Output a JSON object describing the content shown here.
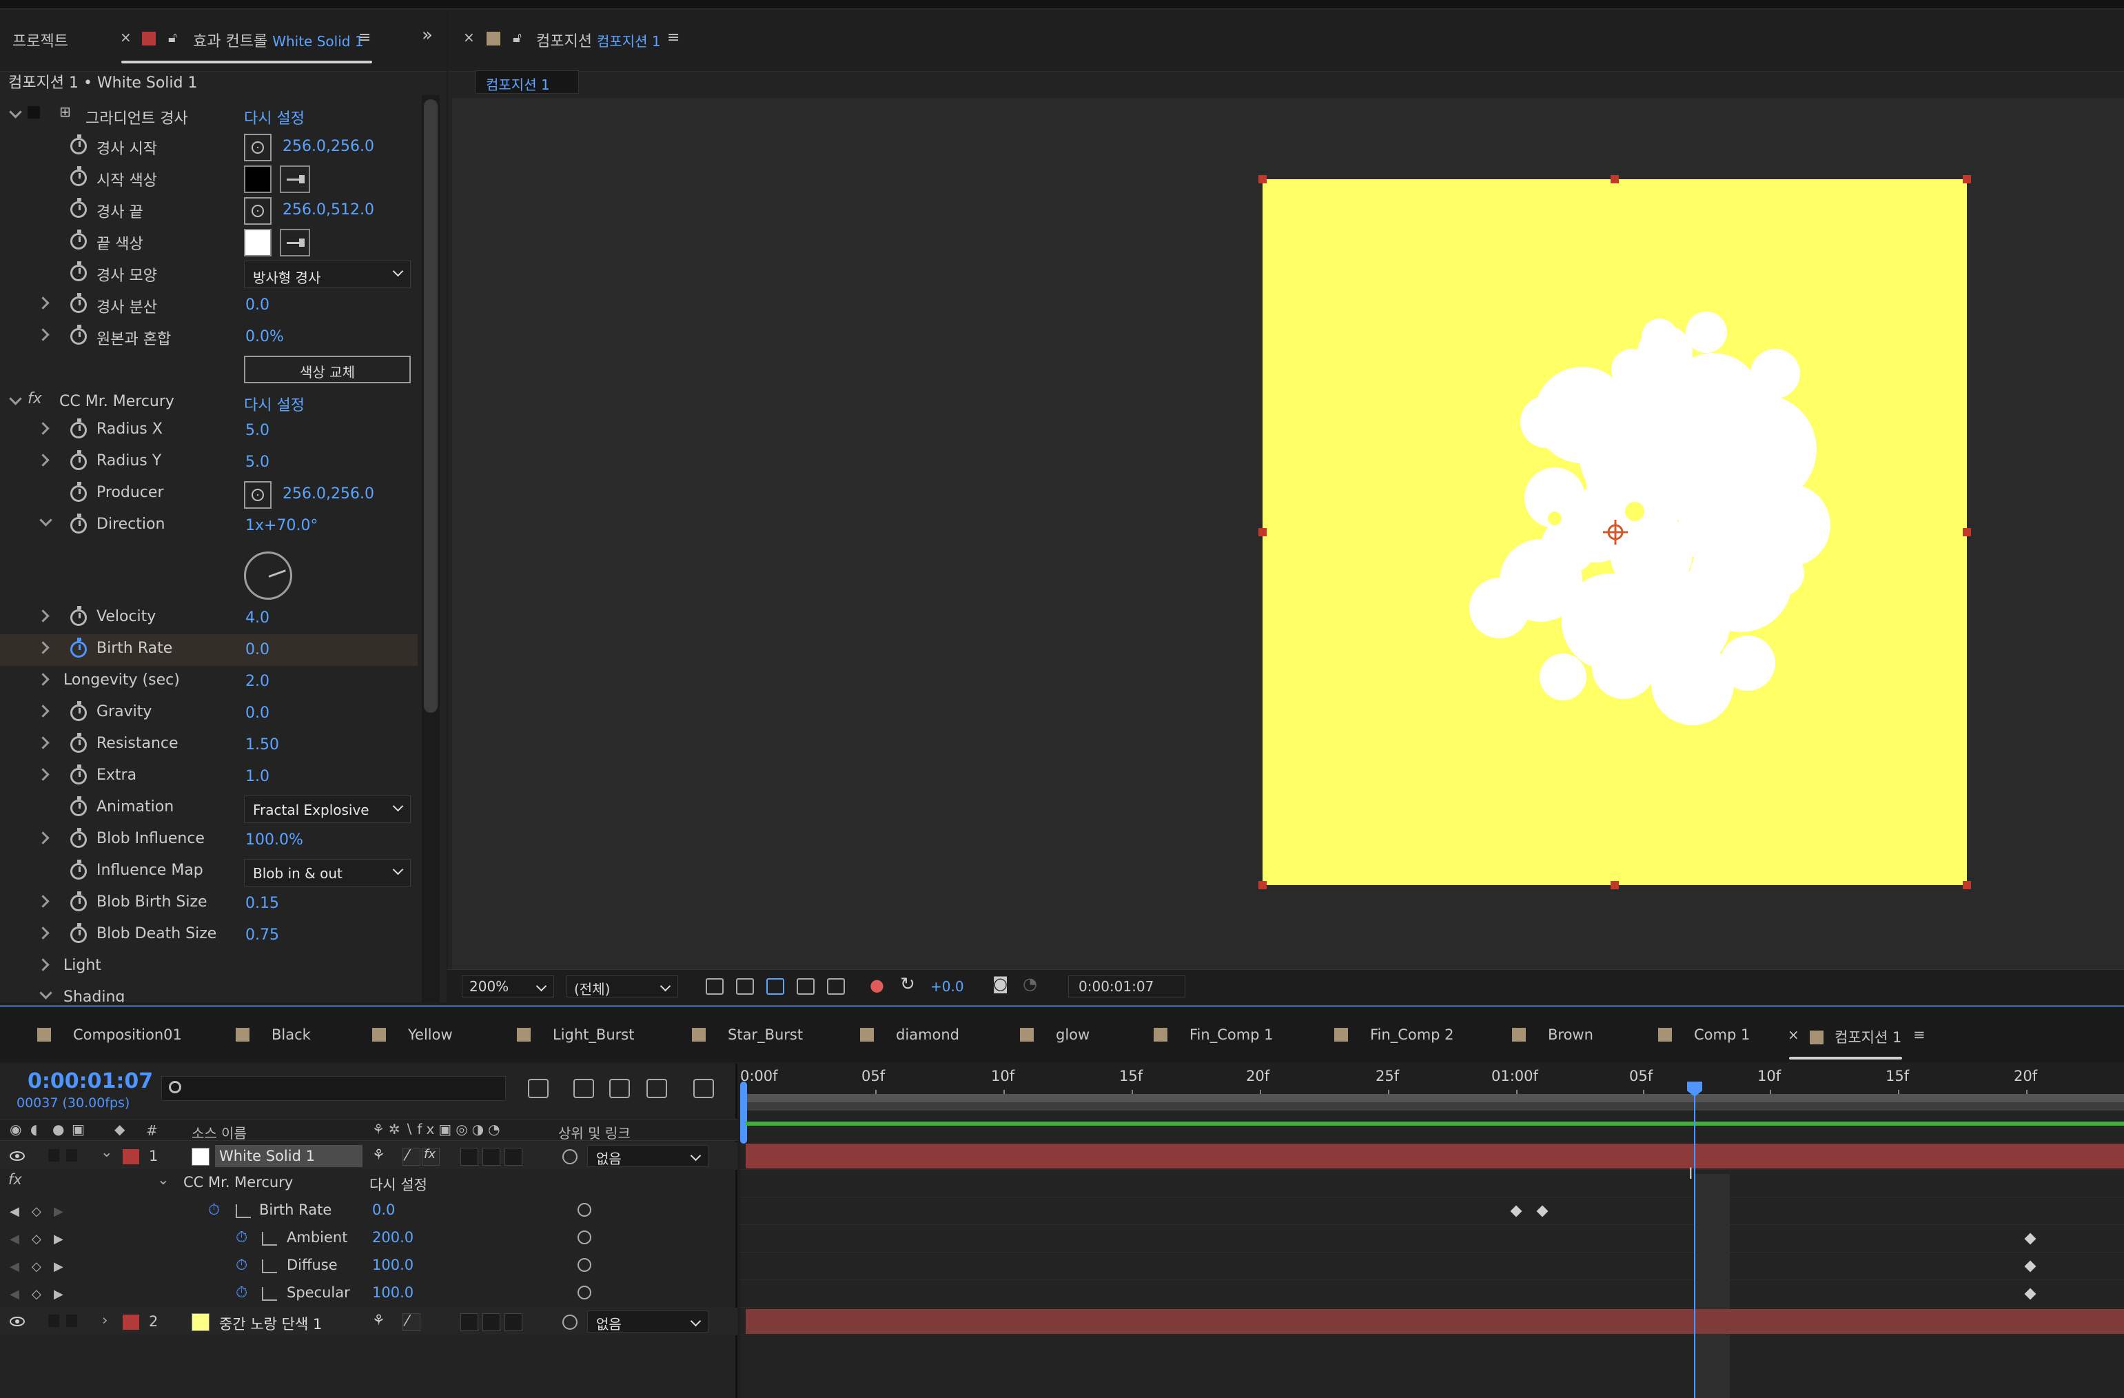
{
  "effects_panel": {
    "tabs": {
      "project": "프로젝트",
      "effect_controls_prefix": "효과 컨트롤",
      "effect_controls_target": "White Solid 1"
    },
    "subtitle": "컴포지션 1 • White Solid 1",
    "gradient": {
      "name": "그라디언트 경사",
      "reset": "다시 설정",
      "start_point": {
        "label": "경사 시작",
        "value": "256.0,256.0"
      },
      "start_color": {
        "label": "시작 색상",
        "color": "#000000"
      },
      "end_point": {
        "label": "경사 끝",
        "value": "256.0,512.0"
      },
      "end_color": {
        "label": "끝 색상",
        "color": "#ffffff"
      },
      "shape": {
        "label": "경사 모양",
        "value": "방사형 경사"
      },
      "scatter": {
        "label": "경사 분산",
        "value": "0.0"
      },
      "blend": {
        "label": "원본과 혼합",
        "value": "0.0%"
      },
      "swap_button": "색상 교체"
    },
    "mercury": {
      "name": "CC Mr. Mercury",
      "reset": "다시 설정",
      "radius_x": {
        "label": "Radius X",
        "value": "5.0"
      },
      "radius_y": {
        "label": "Radius Y",
        "value": "5.0"
      },
      "producer": {
        "label": "Producer",
        "value": "256.0,256.0"
      },
      "direction": {
        "label": "Direction",
        "value": "1x+70.0°"
      },
      "velocity": {
        "label": "Velocity",
        "value": "4.0"
      },
      "birth_rate": {
        "label": "Birth Rate",
        "value": "0.0"
      },
      "longevity": {
        "label": "Longevity (sec)",
        "value": "2.0"
      },
      "gravity": {
        "label": "Gravity",
        "value": "0.0"
      },
      "resistance": {
        "label": "Resistance",
        "value": "1.50"
      },
      "extra": {
        "label": "Extra",
        "value": "1.0"
      },
      "animation": {
        "label": "Animation",
        "value": "Fractal Explosive"
      },
      "blob_influence": {
        "label": "Blob Influence",
        "value": "100.0%"
      },
      "influence_map": {
        "label": "Influence Map",
        "value": "Blob in & out"
      },
      "blob_birth_size": {
        "label": "Blob Birth Size",
        "value": "0.15"
      },
      "blob_death_size": {
        "label": "Blob Death Size",
        "value": "0.75"
      },
      "light": {
        "label": "Light"
      },
      "shading": {
        "label": "Shading"
      }
    }
  },
  "viewer": {
    "tab_prefix": "컴포지션",
    "tab_target": "컴포지션 1",
    "subtab": "컴포지션 1",
    "zoom": "200%",
    "resolution": "(전체)",
    "exposure": "+0.0",
    "timecode": "0:00:01:07",
    "comp_bg_color": "#ffff66"
  },
  "timeline": {
    "tabs": [
      "Composition01",
      "Black",
      "Yellow",
      "Light_Burst",
      "Star_Burst",
      "diamond",
      "glow",
      "Fin_Comp 1",
      "Fin_Comp 2",
      "Brown",
      "Comp 1",
      "컴포지션 1"
    ],
    "active_tab": "컴포지션 1",
    "timecode": "0:00:01:07",
    "frames": "00037 (30.00fps)",
    "col_hash": "#",
    "col_source": "소스 이름",
    "col_parent": "상위 및 링크",
    "ruler": [
      "0:00f",
      "05f",
      "10f",
      "15f",
      "20f",
      "25f",
      "01:00f",
      "05f",
      "10f",
      "15f",
      "20f"
    ],
    "layers": [
      {
        "num": "1",
        "name": "White Solid 1",
        "parent": "없음",
        "thumb": "#ffffff"
      },
      {
        "num": "2",
        "name": "중간 노랑 단색 1",
        "parent": "없음",
        "thumb": "#ffff88"
      }
    ],
    "effect_name": "CC Mr. Mercury",
    "effect_reset": "다시 설정",
    "fx_label": "fx",
    "props": [
      {
        "name": "Birth Rate",
        "value": "0.0"
      },
      {
        "name": "Ambient",
        "value": "200.0"
      },
      {
        "name": "Diffuse",
        "value": "100.0"
      },
      {
        "name": "Specular",
        "value": "100.0"
      }
    ]
  }
}
